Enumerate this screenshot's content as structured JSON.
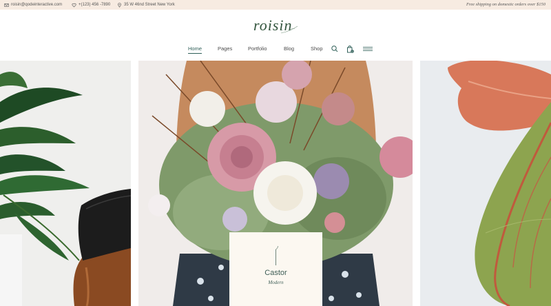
{
  "topbar": {
    "email": "roisin@qodeinteractive.com",
    "phone": "+(123) 456 -7890",
    "address": "35 W 46nd Street New York",
    "shipping": "Free shipping on domestic orders over $150",
    "icons": [
      "mail-icon",
      "heart-icon",
      "location-pin-icon"
    ]
  },
  "logo": {
    "text": "roisin"
  },
  "nav": {
    "items": [
      {
        "label": "Home",
        "active": true
      },
      {
        "label": "Pages"
      },
      {
        "label": "Portfolio"
      },
      {
        "label": "Blog"
      },
      {
        "label": "Shop"
      }
    ],
    "icons": [
      "search-icon",
      "shopping-bag-icon",
      "hamburger-menu-icon"
    ],
    "cart_count": "0"
  },
  "product": {
    "name": "Castor",
    "category": "Modern"
  },
  "colors": {
    "topbar_bg": "#f7ebe1",
    "accent": "#2f5f58",
    "card_bg": "#fcf8f1"
  }
}
